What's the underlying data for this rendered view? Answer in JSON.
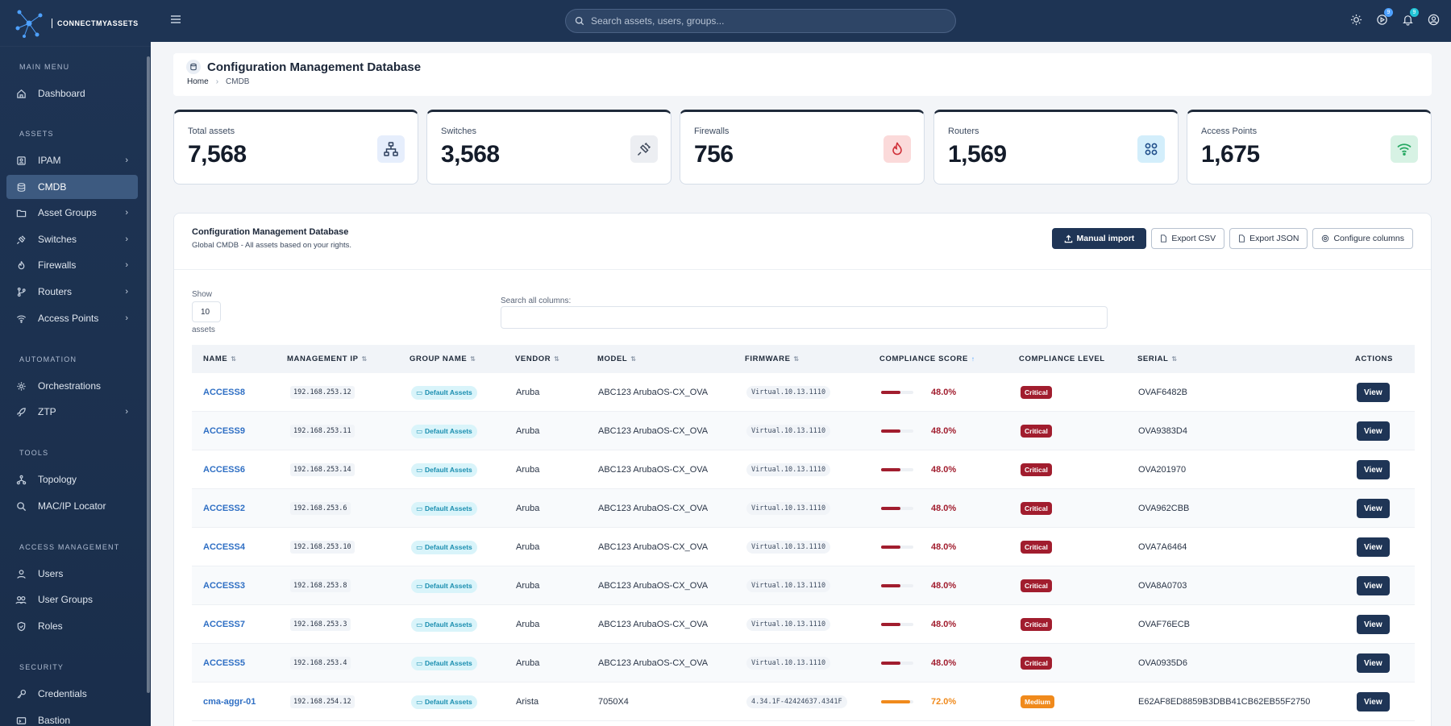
{
  "brand": {
    "name": "CONNECTMYASSETS"
  },
  "sidebar": {
    "sections": [
      {
        "title": "MAIN MENU"
      },
      {
        "title": "ASSETS"
      },
      {
        "title": "AUTOMATION"
      },
      {
        "title": "TOOLS"
      },
      {
        "title": "ACCESS MANAGEMENT"
      },
      {
        "title": "SECURITY"
      }
    ],
    "items": [
      {
        "label": "Dashboard",
        "icon": "home-icon"
      },
      {
        "label": "IPAM",
        "icon": "ipam-icon"
      },
      {
        "label": "CMDB",
        "icon": "database-icon"
      },
      {
        "label": "Asset Groups",
        "icon": "folder-icon"
      },
      {
        "label": "Switches",
        "icon": "plug-icon"
      },
      {
        "label": "Firewalls",
        "icon": "flame-icon"
      },
      {
        "label": "Routers",
        "icon": "branch-icon"
      },
      {
        "label": "Access Points",
        "icon": "wifi-icon"
      },
      {
        "label": "Orchestrations",
        "icon": "gear-icon"
      },
      {
        "label": "ZTP",
        "icon": "rocket-icon"
      },
      {
        "label": "Topology",
        "icon": "topology-icon"
      },
      {
        "label": "MAC/IP Locator",
        "icon": "search-icon"
      },
      {
        "label": "Users",
        "icon": "user-icon"
      },
      {
        "label": "User Groups",
        "icon": "users-icon"
      },
      {
        "label": "Roles",
        "icon": "shield-icon"
      },
      {
        "label": "Credentials",
        "icon": "key-icon"
      },
      {
        "label": "Bastion",
        "icon": "bastion-icon"
      }
    ]
  },
  "topbar": {
    "search_placeholder": "Search assets, users, groups...",
    "notif_count_1": "9",
    "notif_count_2": "9"
  },
  "page": {
    "title": "Configuration Management Database",
    "breadcrumb_home": "Home",
    "breadcrumb_current": "CMDB"
  },
  "stats": [
    {
      "label": "Total assets",
      "value": "7,568",
      "icon": "network-icon",
      "color": "#5b8def"
    },
    {
      "label": "Switches",
      "value": "3,568",
      "icon": "plug-icon",
      "color": "#6b7686"
    },
    {
      "label": "Firewalls",
      "value": "756",
      "icon": "flame-icon",
      "color": "#f3b23b"
    },
    {
      "label": "Routers",
      "value": "1,569",
      "icon": "router-icon",
      "color": "#5b8def"
    },
    {
      "label": "Access Points",
      "value": "1,675",
      "icon": "wifi-icon",
      "color": "#30c6c9"
    }
  ],
  "card": {
    "title": "Configuration Management Database",
    "subtitle": "Global CMDB - All assets based on your rights.",
    "buttons": {
      "manual_import": "Manual import",
      "export_csv": "Export CSV",
      "export_json": "Export JSON",
      "configure_columns": "Configure columns"
    },
    "show_label": "Show",
    "show_value": "10",
    "assets_label": "assets",
    "search_label": "Search all columns:"
  },
  "table": {
    "columns": [
      "NAME",
      "MANAGEMENT IP",
      "GROUP NAME",
      "VENDOR",
      "MODEL",
      "FIRMWARE",
      "COMPLIANCE SCORE",
      "COMPLIANCE LEVEL",
      "SERIAL",
      "ACTIONS"
    ],
    "view_label": "View",
    "rows": [
      {
        "name": "ACCESS8",
        "ip": "192.168.253.12",
        "group": "Default Assets",
        "vendor": "Aruba",
        "model": "ABC123 ArubaOS-CX_OVA",
        "firmware": "Virtual.10.13.1110",
        "score": "48.0%",
        "score_value": 48.0,
        "level": "Critical",
        "serial": "OVAF6482B"
      },
      {
        "name": "ACCESS9",
        "ip": "192.168.253.11",
        "group": "Default Assets",
        "vendor": "Aruba",
        "model": "ABC123 ArubaOS-CX_OVA",
        "firmware": "Virtual.10.13.1110",
        "score": "48.0%",
        "score_value": 48.0,
        "level": "Critical",
        "serial": "OVA9383D4"
      },
      {
        "name": "ACCESS6",
        "ip": "192.168.253.14",
        "group": "Default Assets",
        "vendor": "Aruba",
        "model": "ABC123 ArubaOS-CX_OVA",
        "firmware": "Virtual.10.13.1110",
        "score": "48.0%",
        "score_value": 48.0,
        "level": "Critical",
        "serial": "OVA201970"
      },
      {
        "name": "ACCESS2",
        "ip": "192.168.253.6",
        "group": "Default Assets",
        "vendor": "Aruba",
        "model": "ABC123 ArubaOS-CX_OVA",
        "firmware": "Virtual.10.13.1110",
        "score": "48.0%",
        "score_value": 48.0,
        "level": "Critical",
        "serial": "OVA962CBB"
      },
      {
        "name": "ACCESS4",
        "ip": "192.168.253.10",
        "group": "Default Assets",
        "vendor": "Aruba",
        "model": "ABC123 ArubaOS-CX_OVA",
        "firmware": "Virtual.10.13.1110",
        "score": "48.0%",
        "score_value": 48.0,
        "level": "Critical",
        "serial": "OVA7A6464"
      },
      {
        "name": "ACCESS3",
        "ip": "192.168.253.8",
        "group": "Default Assets",
        "vendor": "Aruba",
        "model": "ABC123 ArubaOS-CX_OVA",
        "firmware": "Virtual.10.13.1110",
        "score": "48.0%",
        "score_value": 48.0,
        "level": "Critical",
        "serial": "OVA8A0703"
      },
      {
        "name": "ACCESS7",
        "ip": "192.168.253.3",
        "group": "Default Assets",
        "vendor": "Aruba",
        "model": "ABC123 ArubaOS-CX_OVA",
        "firmware": "Virtual.10.13.1110",
        "score": "48.0%",
        "score_value": 48.0,
        "level": "Critical",
        "serial": "OVAF76ECB"
      },
      {
        "name": "ACCESS5",
        "ip": "192.168.253.4",
        "group": "Default Assets",
        "vendor": "Aruba",
        "model": "ABC123 ArubaOS-CX_OVA",
        "firmware": "Virtual.10.13.1110",
        "score": "48.0%",
        "score_value": 48.0,
        "level": "Critical",
        "serial": "OVA0935D6"
      },
      {
        "name": "cma-aggr-01",
        "ip": "192.168.254.12",
        "group": "Default Assets",
        "vendor": "Arista",
        "model": "7050X4",
        "firmware": "4.34.1F-42424637.4341F",
        "score": "72.0%",
        "score_value": 72.0,
        "level": "Medium",
        "serial": "E62AF8ED8859B3DBB41CB62EB55F2750"
      }
    ]
  },
  "colors": {
    "critical": "#a11d2e",
    "medium": "#f08a1c",
    "accent": "#1f3556"
  }
}
